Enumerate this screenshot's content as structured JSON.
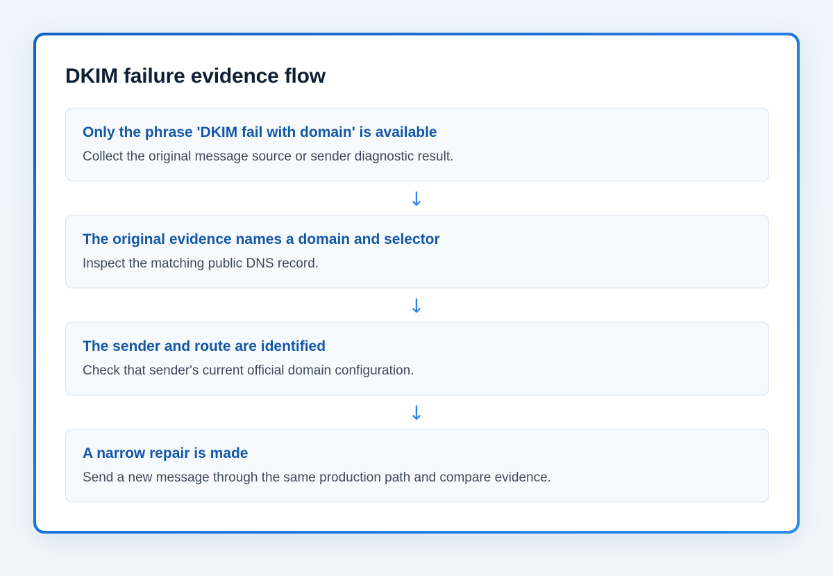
{
  "title": "DKIM failure evidence flow",
  "steps": [
    {
      "heading": "Only the phrase 'DKIM fail with domain' is available",
      "body": "Collect the original message source or sender diagnostic result."
    },
    {
      "heading": "The original evidence names a domain and selector",
      "body": "Inspect the matching public DNS record."
    },
    {
      "heading": "The sender and route are identified",
      "body": "Check that sender's current official domain configuration."
    },
    {
      "heading": "A narrow repair is made",
      "body": "Send a new message through the same production path and compare evidence."
    }
  ],
  "connector": {
    "glyph": "↓",
    "icon": "arrow-down-icon",
    "color": "#2a86e6"
  },
  "colors": {
    "border_accent": "#1f74d6",
    "heading": "#1357a6",
    "title": "#0f1f33"
  }
}
